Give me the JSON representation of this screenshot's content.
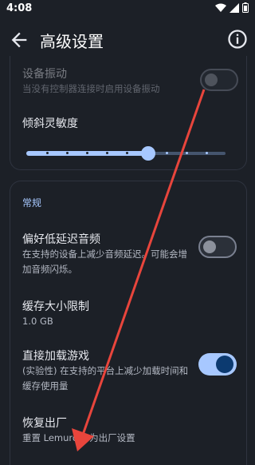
{
  "status": {
    "time": "4:08"
  },
  "header": {
    "title": "高级设置"
  },
  "settings": {
    "vibration": {
      "title": "设备振动",
      "subtitle": "当没有控制器连接时启用设备振动",
      "enabled": false
    },
    "tilt": {
      "title": "倾斜灵敏度",
      "level": 0.61
    },
    "general": {
      "header": "常规",
      "low_latency": {
        "title": "偏好低延迟音频",
        "subtitle": "在支持的设备上减少音频延迟。可能会增加音频闪烁。",
        "enabled": false
      },
      "cache": {
        "title": "缓存大小限制",
        "value": "1.0 GB"
      },
      "direct_load": {
        "title": "直接加载游戏",
        "subtitle": "(实验性) 在支持的平台上减少加载时间和缓存使用量",
        "enabled": true
      },
      "factory_reset": {
        "title": "恢复出厂",
        "subtitle": "重置 Lemuroid 为出厂设置"
      }
    }
  },
  "colors": {
    "accent": "#a7c8ff",
    "arrow": "#e8453c",
    "background": "#1c2027"
  }
}
